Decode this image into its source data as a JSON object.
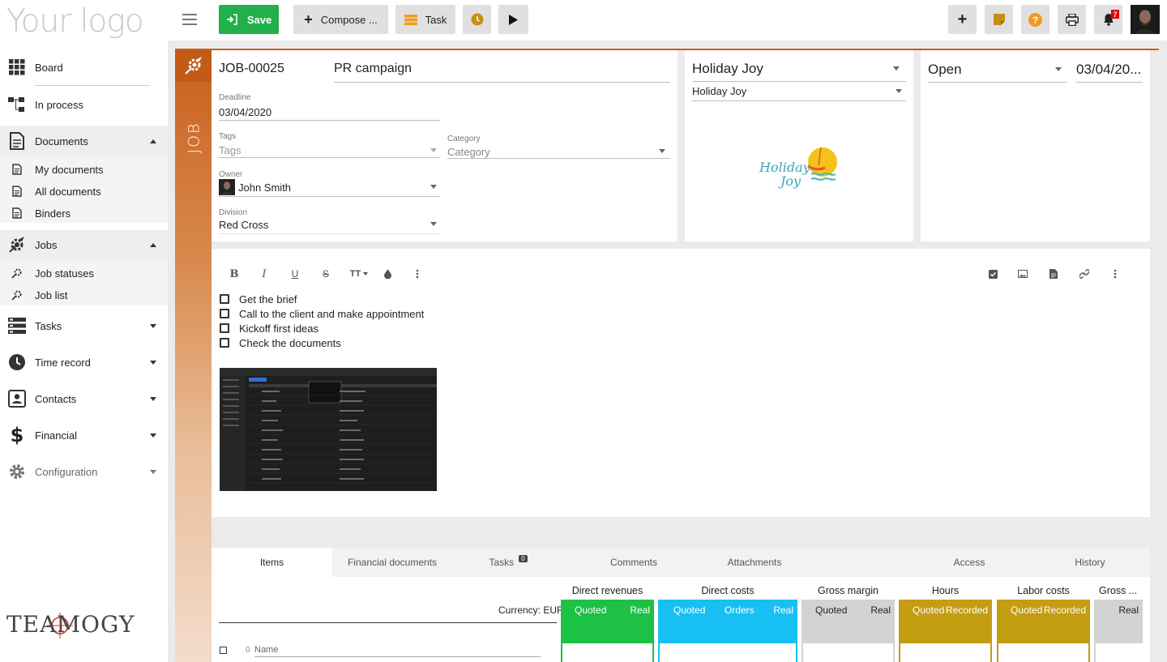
{
  "app": {
    "logo_text": "Your logo",
    "brand_text": "TEAMOGY"
  },
  "sidebar": {
    "items": [
      {
        "label": "Board",
        "icon": "grid-icon"
      },
      {
        "label": "In process",
        "icon": "flow-icon"
      },
      {
        "label": "Documents",
        "icon": "document-icon",
        "expanded": true
      },
      {
        "label": "My documents",
        "icon": "document-small-icon"
      },
      {
        "label": "All documents",
        "icon": "document-small-icon"
      },
      {
        "label": "Binders",
        "icon": "document-small-icon"
      },
      {
        "label": "Jobs",
        "icon": "rocket-gear-icon",
        "expanded": true
      },
      {
        "label": "Job statuses",
        "icon": "rocket-small-icon"
      },
      {
        "label": "Job list",
        "icon": "rocket-small-icon"
      },
      {
        "label": "Tasks",
        "icon": "tasks-icon"
      },
      {
        "label": "Time record",
        "icon": "clock-icon"
      },
      {
        "label": "Contacts",
        "icon": "contact-card-icon"
      },
      {
        "label": "Financial",
        "icon": "dollar-icon"
      },
      {
        "label": "Configuration",
        "icon": "gear-icon"
      }
    ]
  },
  "toolbar": {
    "save_label": "Save",
    "compose_label": "Compose ...",
    "task_label": "Task",
    "notification_count": "7",
    "colors": {
      "save": "#21b04b",
      "orange": "#f29a1e",
      "question": "#f29a1e"
    }
  },
  "job": {
    "side_label": "JOB",
    "number": "JOB-00025",
    "title": "PR campaign",
    "deadline_label": "Deadline",
    "deadline": "03/04/2020",
    "tags_label": "Tags",
    "tags_placeholder": "Tags",
    "category_label": "Category",
    "category_placeholder": "Category",
    "owner_label": "Owner",
    "owner": "John Smith",
    "division_label": "Division",
    "division": "Red Cross",
    "accent": "#c8601e"
  },
  "client": {
    "name": "Holiday Joy",
    "contact": "Holiday Joy",
    "logo_line1": "Holiday",
    "logo_line2": "Joy"
  },
  "status": {
    "value": "Open",
    "date": "03/04/20..."
  },
  "editor": {
    "checklist": [
      "Get the brief",
      "Call to the client and make appointment",
      "Kickoff first ideas",
      "Check the documents"
    ],
    "font_size_label": "TT"
  },
  "tabs": {
    "items": [
      "Items",
      "Financial documents",
      "Tasks",
      "Comments",
      "Attachments",
      "Access",
      "History"
    ],
    "tasks_badge": "0",
    "active": "Items"
  },
  "items_table": {
    "currency_label": "Currency: EUR",
    "name_header": "Name",
    "row_number": "0",
    "groups": [
      {
        "title": "Direct revenues",
        "color": "#1cc145",
        "subs": [
          "Quoted",
          "Real"
        ]
      },
      {
        "title": "Direct costs",
        "color": "#18bff2",
        "subs": [
          "Quoted",
          "Orders",
          "Real"
        ]
      },
      {
        "title": "Gross margin",
        "color": "#d3d3d3",
        "subs": [
          "Quoted",
          "Real"
        ]
      },
      {
        "title": "Hours",
        "color": "#c39d12",
        "subs": [
          "Quoted",
          "Recorded"
        ]
      },
      {
        "title": "Labor costs",
        "color": "#c39d12",
        "subs": [
          "Quoted",
          "Recorded"
        ]
      },
      {
        "title": "Gross ...",
        "color": "#d3d3d3",
        "subs": [
          "Real"
        ]
      }
    ]
  }
}
